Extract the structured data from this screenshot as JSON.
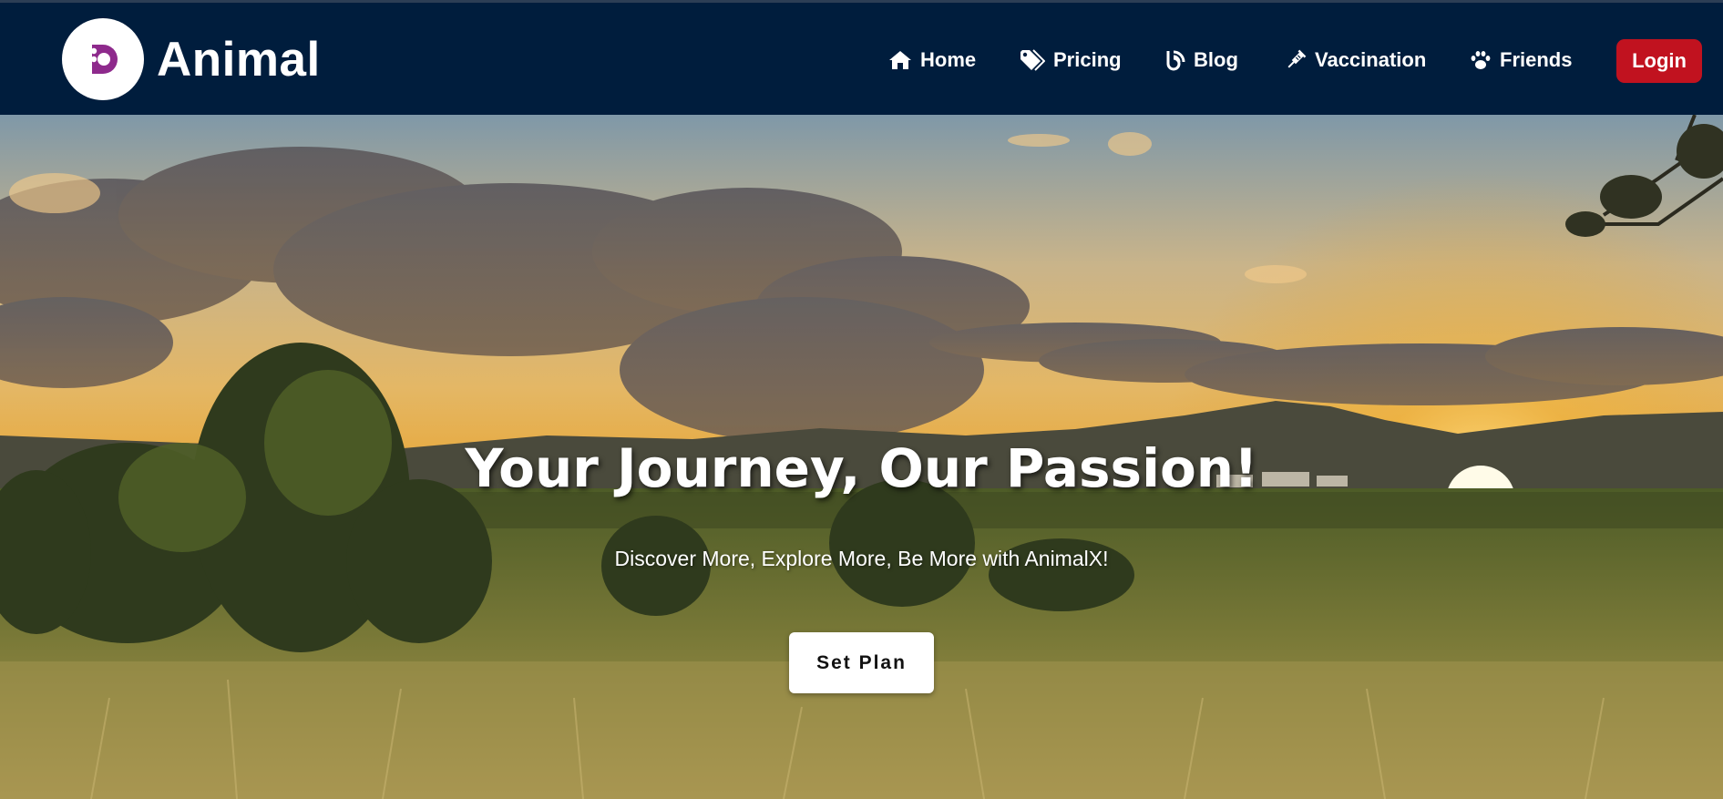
{
  "brand": {
    "name": "Animal",
    "logo_icon": "paw-d-logo-icon",
    "logo_color": "#8e2a8c"
  },
  "nav": {
    "items": [
      {
        "label": "Home",
        "icon": "home-icon"
      },
      {
        "label": "Pricing",
        "icon": "tag-icon"
      },
      {
        "label": "Blog",
        "icon": "blog-icon"
      },
      {
        "label": "Vaccination",
        "icon": "syringe-icon"
      },
      {
        "label": "Friends",
        "icon": "paw-icon"
      }
    ],
    "login_label": "Login"
  },
  "hero": {
    "title": "Your Journey, Our Passion!",
    "subtitle": "Discover More, Explore More, Be More with AnimalX!",
    "cta_label": "Set Plan"
  },
  "colors": {
    "navbar_bg": "#001d3d",
    "login_bg": "#c1121f",
    "text_on_dark": "#ffffff"
  }
}
